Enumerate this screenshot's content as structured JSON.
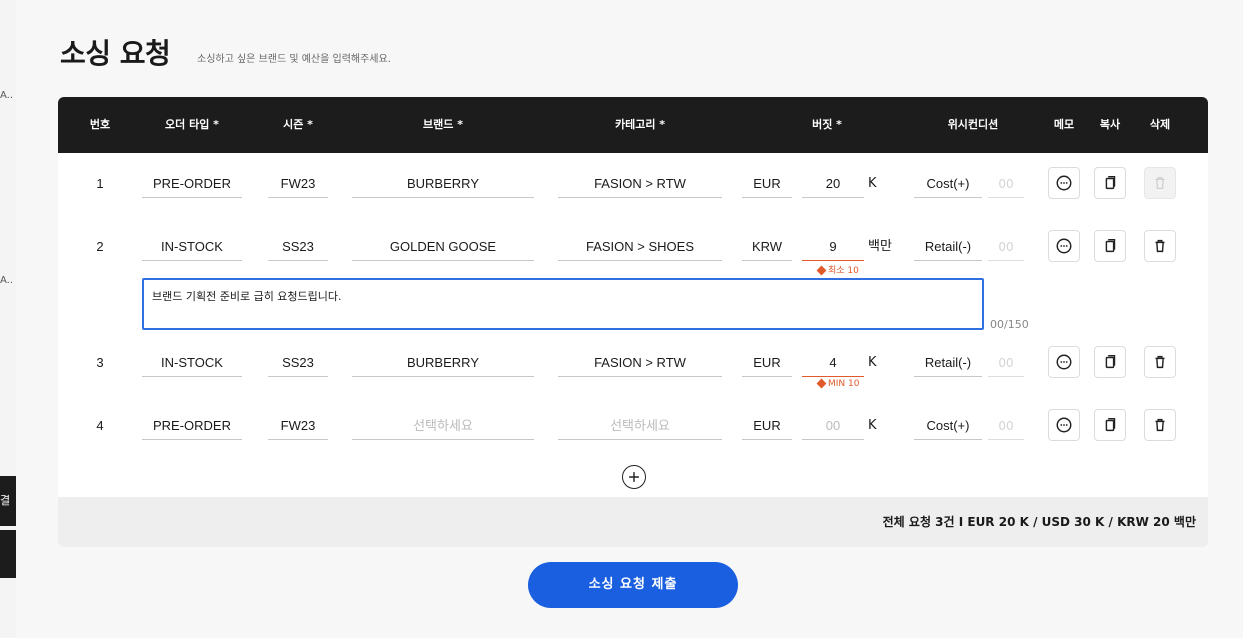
{
  "background": {
    "ellipsis_1": "A..",
    "ellipsis_2": "A..",
    "button_fragment": "결과"
  },
  "page": {
    "title": "소싱 요청",
    "subtitle": "소싱하고 싶은 브랜드 및 예산을 입력해주세요."
  },
  "table": {
    "headers": {
      "no": "번호",
      "order_type": "오더 타입 *",
      "season": "시즌 *",
      "brand": "브랜드 *",
      "category": "카테고리 *",
      "budget": "버짓 *",
      "wish_condition": "위시컨디션",
      "memo": "메모",
      "copy": "복사",
      "delete": "삭제"
    },
    "rows": [
      {
        "no": "1",
        "order_type": "PRE-ORDER",
        "season": "FW23",
        "brand": "BURBERRY",
        "category": "FASION > RTW",
        "currency": "EUR",
        "budget": "20",
        "unit": "K",
        "wish": "Cost(+)",
        "wish_value": "00",
        "warning": ""
      },
      {
        "no": "2",
        "order_type": "IN-STOCK",
        "season": "SS23",
        "brand": "GOLDEN GOOSE",
        "category": "FASION > SHOES",
        "currency": "KRW",
        "budget": "9",
        "unit": "백만",
        "wish": "Retail(-)",
        "wish_value": "00",
        "warning": "최소 10",
        "memo_text": "브랜드 기획전 준비로 급히 요청드립니다.",
        "memo_count": "00/150"
      },
      {
        "no": "3",
        "order_type": "IN-STOCK",
        "season": "SS23",
        "brand": "BURBERRY",
        "category": "FASION > RTW",
        "currency": "EUR",
        "budget": "4",
        "unit": "K",
        "wish": "Retail(-)",
        "wish_value": "00",
        "warning": "MIN 10"
      },
      {
        "no": "4",
        "order_type": "PRE-ORDER",
        "season": "FW23",
        "brand": "선택하세요",
        "category": "선택하세요",
        "currency": "EUR",
        "budget": "00",
        "unit": "K",
        "wish": "Cost(+)",
        "wish_value": "00",
        "warning": ""
      }
    ],
    "icons": {
      "memo": "chat-bubble-icon",
      "copy": "copy-icon",
      "delete": "trash-icon",
      "add": "plus-circle-icon"
    }
  },
  "summary": {
    "text": "전체 요청 3건 I EUR 20 K / USD 30 K / KRW 20 백만"
  },
  "submit": {
    "label": "소싱 요청 제출"
  },
  "colors": {
    "header_bg": "#1c1c1c",
    "accent": "#1a5fe0",
    "memo_border": "#2f6fe0",
    "warning": "#e05a2a"
  }
}
